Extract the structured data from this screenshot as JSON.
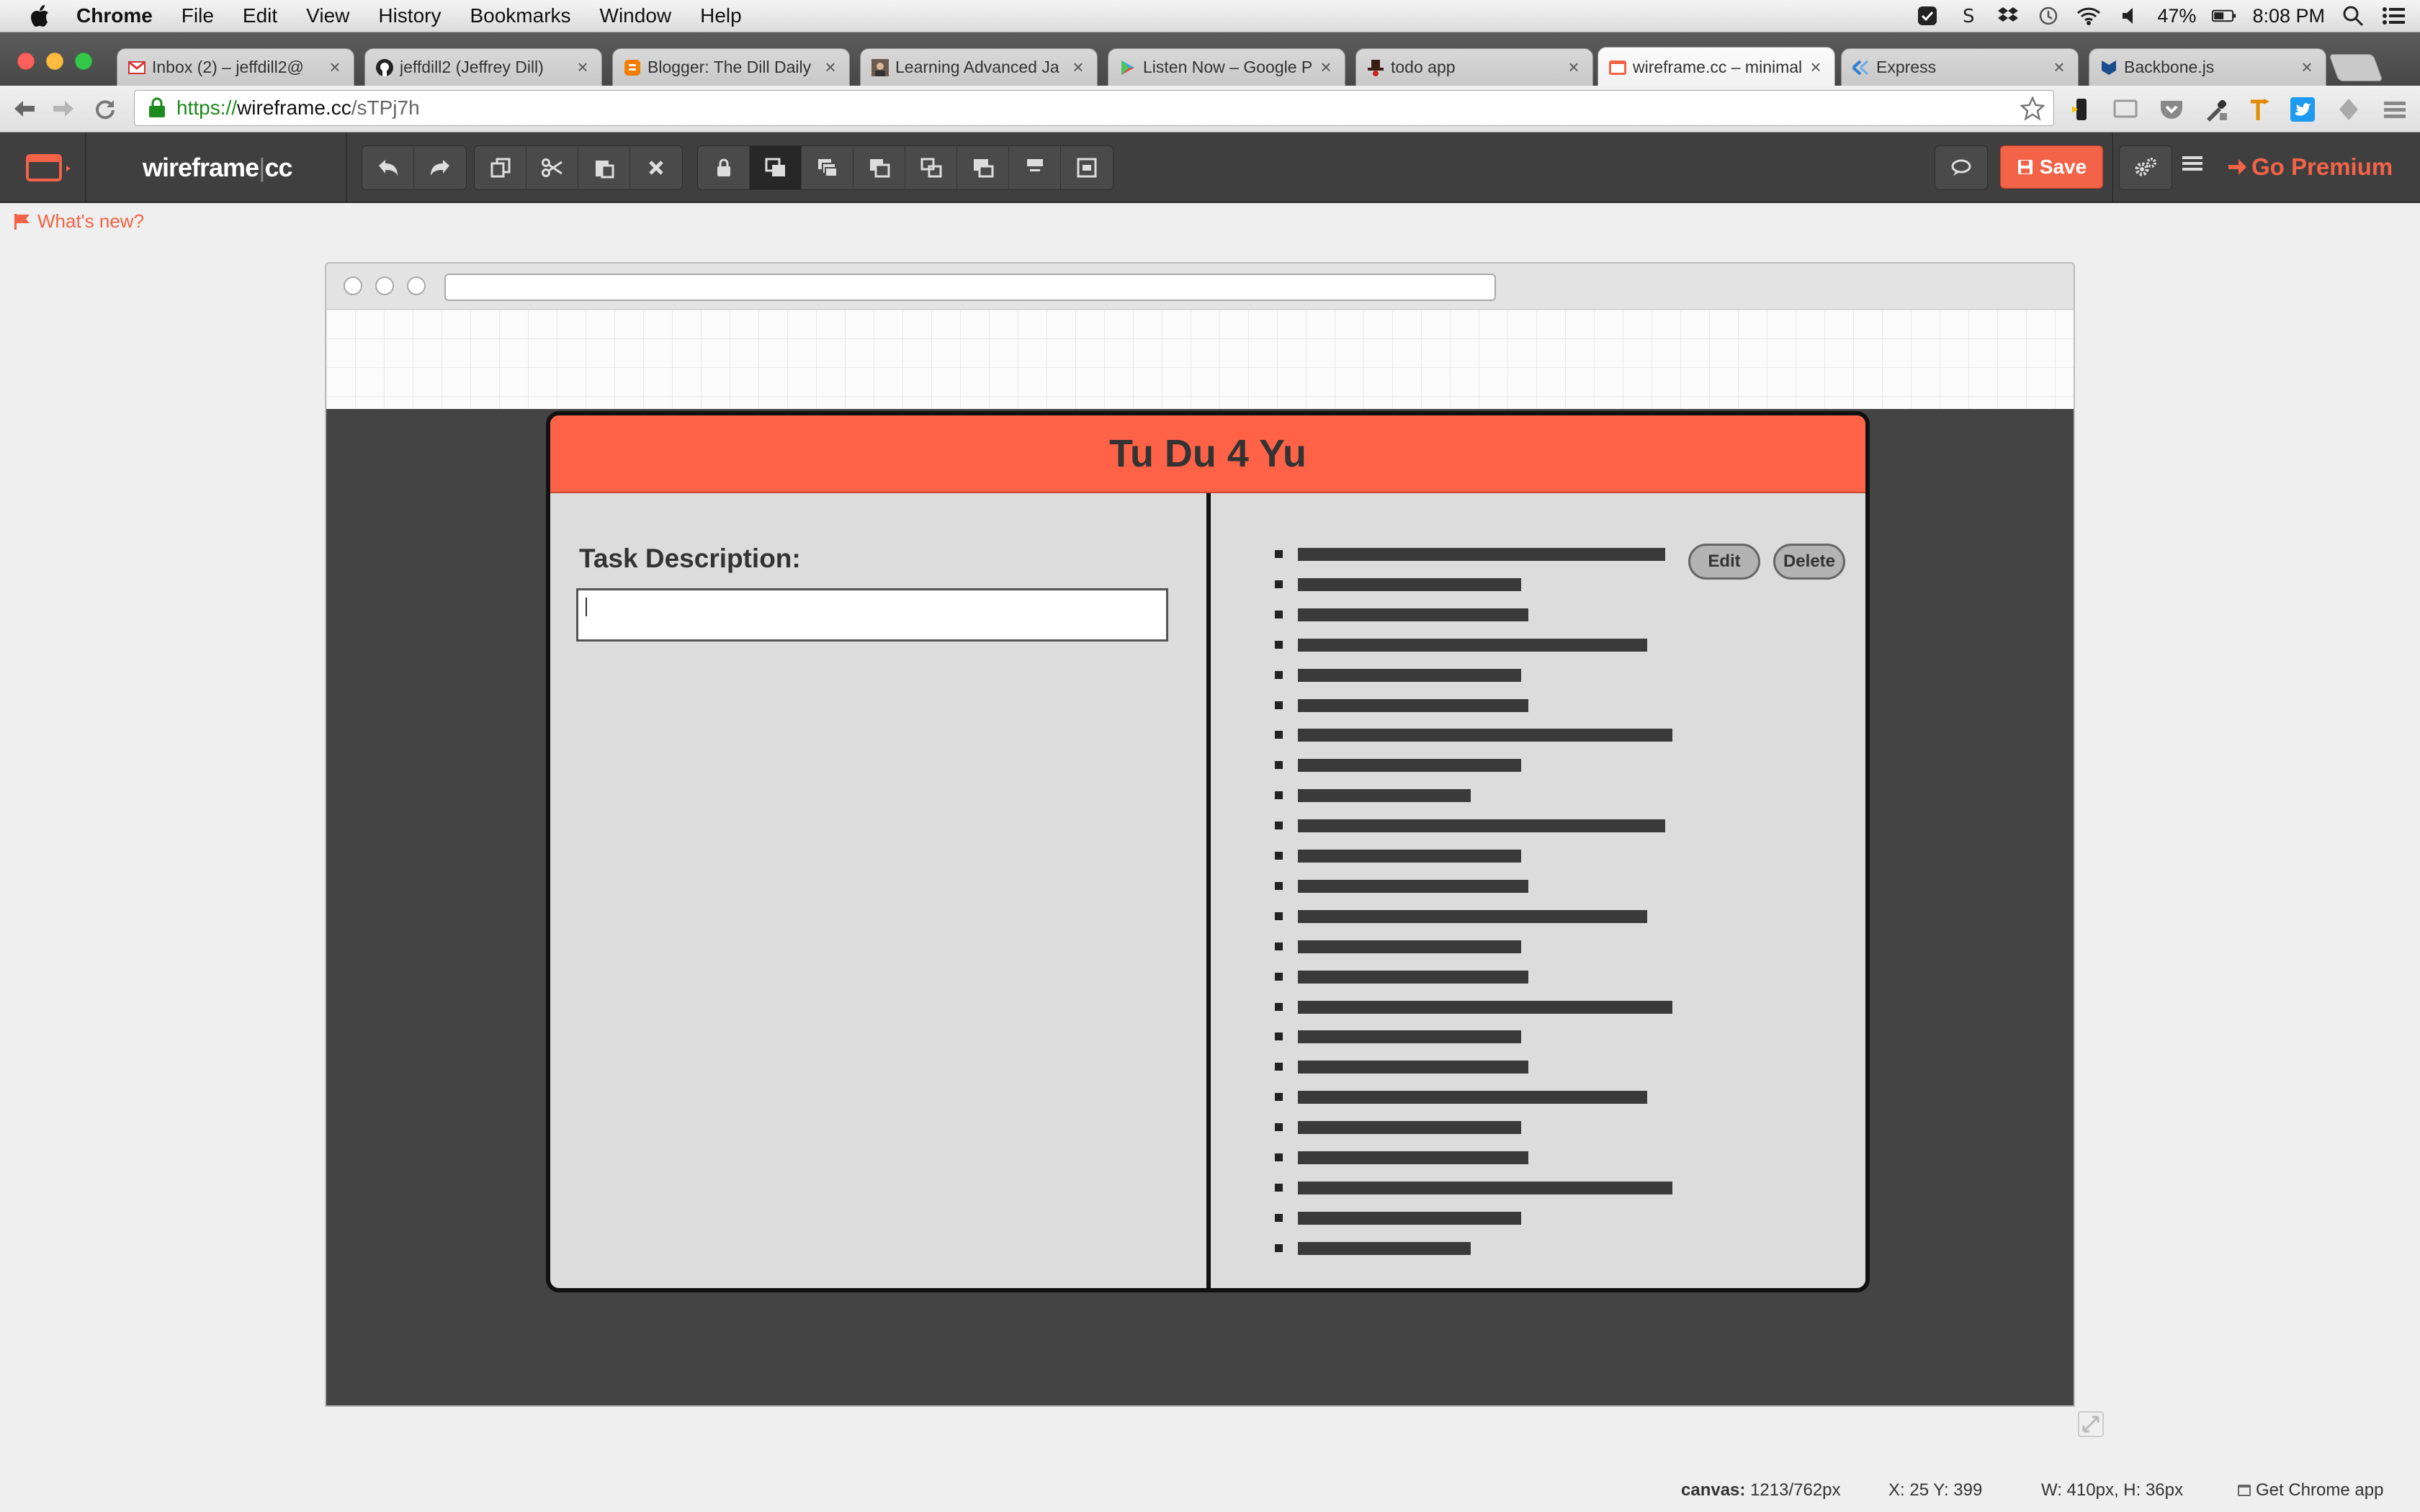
{
  "menubar": {
    "items": [
      "Chrome",
      "File",
      "Edit",
      "View",
      "History",
      "Bookmarks",
      "Window",
      "Help"
    ],
    "battery": "47%",
    "clock": "8:08 PM"
  },
  "tabs": [
    {
      "title": "Inbox (2) – jeffdill2@",
      "icon": "gmail-icon"
    },
    {
      "title": "jeffdill2 (Jeffrey Dill)",
      "icon": "github-icon"
    },
    {
      "title": "Blogger: The Dill Daily",
      "icon": "blogger-icon"
    },
    {
      "title": "Learning Advanced Ja",
      "icon": "avatar-icon"
    },
    {
      "title": "Listen Now – Google P",
      "icon": "play-icon"
    },
    {
      "title": "todo app",
      "icon": "hat-icon"
    },
    {
      "title": "wireframe.cc – minimal",
      "icon": "wireframe-icon"
    },
    {
      "title": "Express",
      "icon": "express-icon"
    },
    {
      "title": "Backbone.js",
      "icon": "backbone-icon"
    }
  ],
  "address": {
    "scheme": "https://",
    "host": "wireframe.cc",
    "path": "/sTPj7h"
  },
  "app": {
    "logo_main": "wireframe",
    "logo_pipe": "|",
    "logo_cc": "cc",
    "save_label": "Save",
    "premium_label": "Go Premium",
    "whats_new": "What's new?"
  },
  "mockup": {
    "title": "Tu Du 4 Yu",
    "task_label": "Task Description:",
    "edit_label": "Edit",
    "delete_label": "Delete"
  },
  "status": {
    "canvas_label": "canvas:",
    "canvas_value": "1213/762px",
    "xy": "X: 25 Y: 399",
    "wh": "W: 410px, H: 36px",
    "chrome_app": "Get Chrome app"
  },
  "colors": {
    "accent": "#f26347",
    "mock_header": "#ff6347",
    "toolbar": "#3f3f3f"
  }
}
